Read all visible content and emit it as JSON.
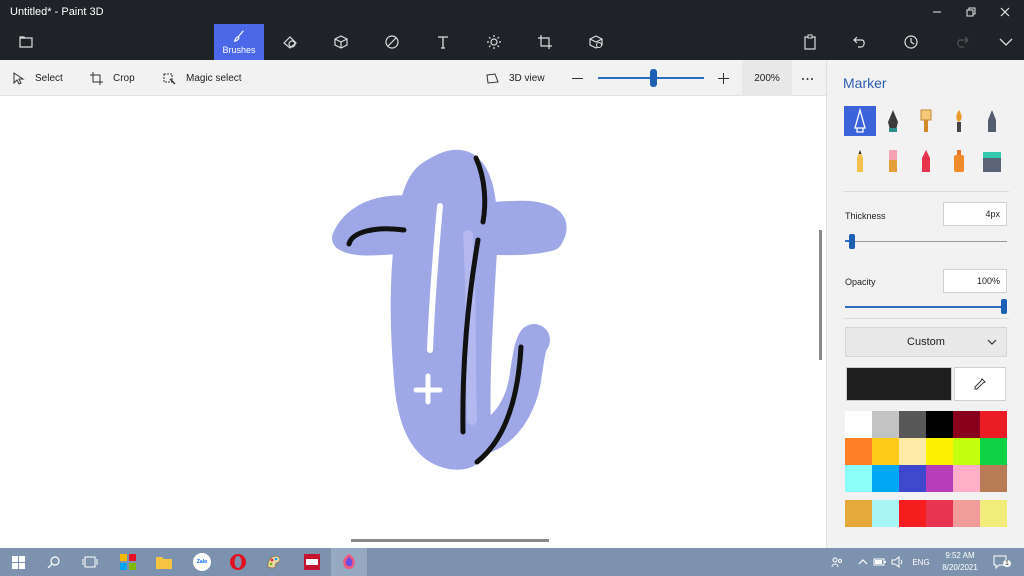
{
  "window": {
    "title": "Untitled* - Paint 3D"
  },
  "toolbar": {
    "active_tab_label": "Brushes",
    "icons": [
      "menu-folder-icon",
      "brushes-icon",
      "2d-shapes-icon",
      "3d-shapes-icon",
      "stickers-icon",
      "text-icon",
      "effects-icon",
      "canvas-icon",
      "3d-library-icon",
      "paste-icon",
      "undo-icon",
      "history-icon",
      "redo-icon",
      "expand-icon"
    ]
  },
  "subtoolbar": {
    "select_label": "Select",
    "crop_label": "Crop",
    "magic_select_label": "Magic select",
    "view3d_label": "3D view",
    "zoom_value": "200%",
    "zoom_level_fraction": 0.53
  },
  "panel": {
    "title": "Marker",
    "brushes": [
      "marker",
      "calligraphy-pen",
      "oil-brush",
      "watercolor",
      "pixel-pen",
      "pencil",
      "eraser",
      "crayon",
      "spray-can",
      "fill"
    ],
    "selected_brush": "marker",
    "thickness_label": "Thickness",
    "thickness_value": "4px",
    "thickness_fraction": 0.04,
    "opacity_label": "Opacity",
    "opacity_value": "100%",
    "opacity_fraction": 1.0,
    "color_mode": "Custom",
    "current_color": "#1e1e1e",
    "swatches": [
      "#ffffff",
      "#c3c3c3",
      "#585858",
      "#000000",
      "#88001b",
      "#ec1c24",
      "#ff7f27",
      "#ffca18",
      "#fdeca6",
      "#fff200",
      "#c4ff0e",
      "#0ed145",
      "#8cfffb",
      "#00a8f3",
      "#3f48cc",
      "#b83dba",
      "#ffaec8",
      "#b97a56",
      "#e5a83b",
      "#a8f5f5",
      "#f51d1d",
      "#e8344e",
      "#f29b9b",
      "#f2ec7a"
    ]
  },
  "taskbar": {
    "apps": [
      "start-icon",
      "search-icon",
      "task-view-icon",
      "app-grid-icon",
      "file-explorer-icon",
      "zalo-icon",
      "opera-icon",
      "paint-icon",
      "video-app-icon",
      "paint3d-icon"
    ],
    "zalo_label": "Zalo",
    "language": "ENG",
    "time": "9:52 AM",
    "date": "8/20/2021",
    "notification_count": "1"
  },
  "colors": {
    "accent": "#4a68e8",
    "titlebar": "#1f2227",
    "drawing_fill": "#9fa7e6",
    "drawing_stroke": "#111111"
  }
}
